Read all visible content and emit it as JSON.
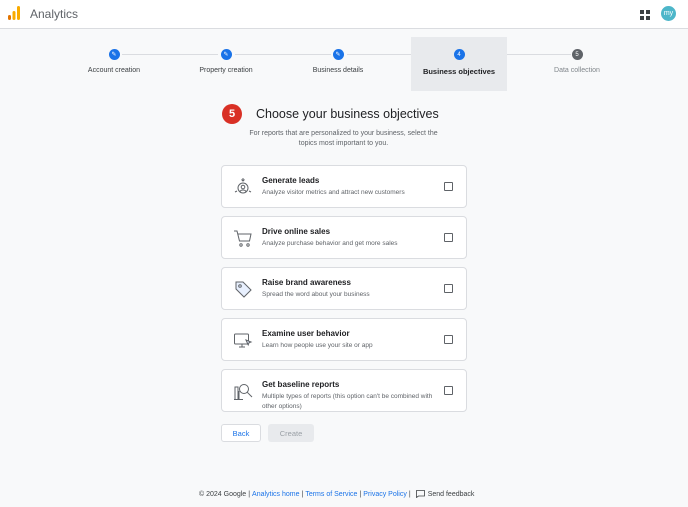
{
  "app": {
    "title": "Analytics",
    "avatar_text": "my"
  },
  "stepper": {
    "steps": [
      {
        "label": "Account creation",
        "state": "done",
        "number": ""
      },
      {
        "label": "Property creation",
        "state": "done",
        "number": ""
      },
      {
        "label": "Business details",
        "state": "done",
        "number": ""
      },
      {
        "label": "Business objectives",
        "state": "active",
        "number": "4"
      },
      {
        "label": "Data collection",
        "state": "pending",
        "number": "5"
      }
    ]
  },
  "main": {
    "step_badge": "5",
    "heading": "Choose your business objectives",
    "subtext": "For reports that are personalized to your business, select the topics most important to you.",
    "options": [
      {
        "title": "Generate leads",
        "description": "Analyze visitor metrics and attract new customers",
        "icon": "target-person-icon",
        "checked": false
      },
      {
        "title": "Drive online sales",
        "description": "Analyze purchase behavior and get more sales",
        "icon": "shopping-cart-icon",
        "checked": false
      },
      {
        "title": "Raise brand awareness",
        "description": "Spread the word about your business",
        "icon": "tag-icon",
        "checked": false
      },
      {
        "title": "Examine user behavior",
        "description": "Learn how people use your site or app",
        "icon": "monitor-cursor-icon",
        "checked": false
      },
      {
        "title": "Get baseline reports",
        "description": "Multiple types of reports (this option can't be combined with other options)",
        "icon": "magnify-report-icon",
        "checked": false
      }
    ],
    "back_label": "Back",
    "create_label": "Create"
  },
  "footer": {
    "copyright": "© 2024 Google",
    "links": [
      "Analytics home",
      "Terms of Service",
      "Privacy Policy"
    ],
    "feedback": "Send feedback"
  },
  "colors": {
    "accent": "#1a73e8",
    "badge": "#d93025",
    "logo_orange": "#f9ab00",
    "logo_dark": "#e37400"
  }
}
